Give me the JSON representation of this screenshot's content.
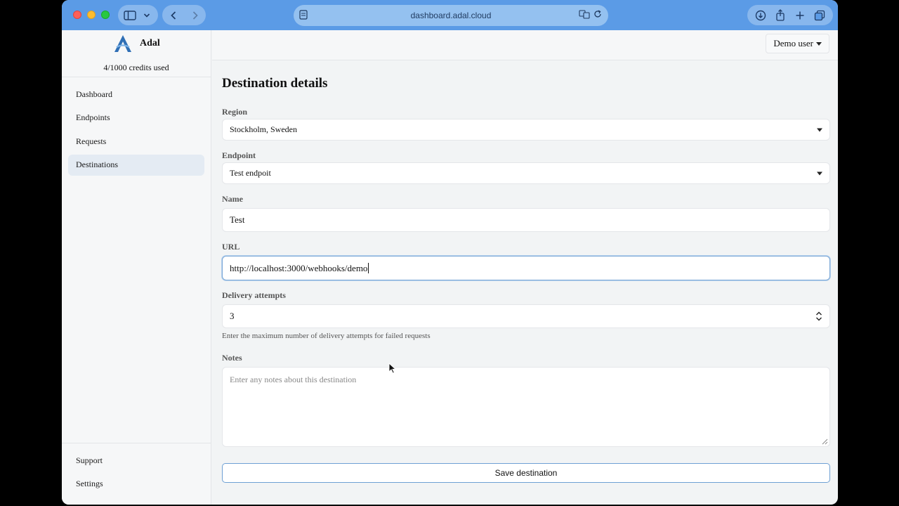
{
  "browser": {
    "url": "dashboard.adal.cloud"
  },
  "brand": {
    "name": "Adal",
    "credits": "4/1000 credits used"
  },
  "sidebar": {
    "items": [
      {
        "label": "Dashboard"
      },
      {
        "label": "Endpoints"
      },
      {
        "label": "Requests"
      },
      {
        "label": "Destinations",
        "active": true
      }
    ],
    "bottom_items": [
      {
        "label": "Support"
      },
      {
        "label": "Settings"
      }
    ]
  },
  "header": {
    "user_menu": "Demo user"
  },
  "form": {
    "title": "Destination details",
    "region": {
      "label": "Region",
      "value": "Stockholm, Sweden"
    },
    "endpoint": {
      "label": "Endpoint",
      "value": "Test endpoit"
    },
    "name": {
      "label": "Name",
      "value": "Test"
    },
    "url": {
      "label": "URL",
      "value": "http://localhost:3000/webhooks/demo"
    },
    "delivery_attempts": {
      "label": "Delivery attempts",
      "value": "3",
      "help": "Enter the maximum number of delivery attempts for failed requests"
    },
    "notes": {
      "label": "Notes",
      "placeholder": "Enter any notes about this destination"
    },
    "submit_label": "Save destination"
  },
  "colors": {
    "titlebar": "#5b9be6",
    "active_nav": "#e4ebf3",
    "focus_border": "#7aa7d6",
    "brand_logo": "#2f6fb5"
  }
}
